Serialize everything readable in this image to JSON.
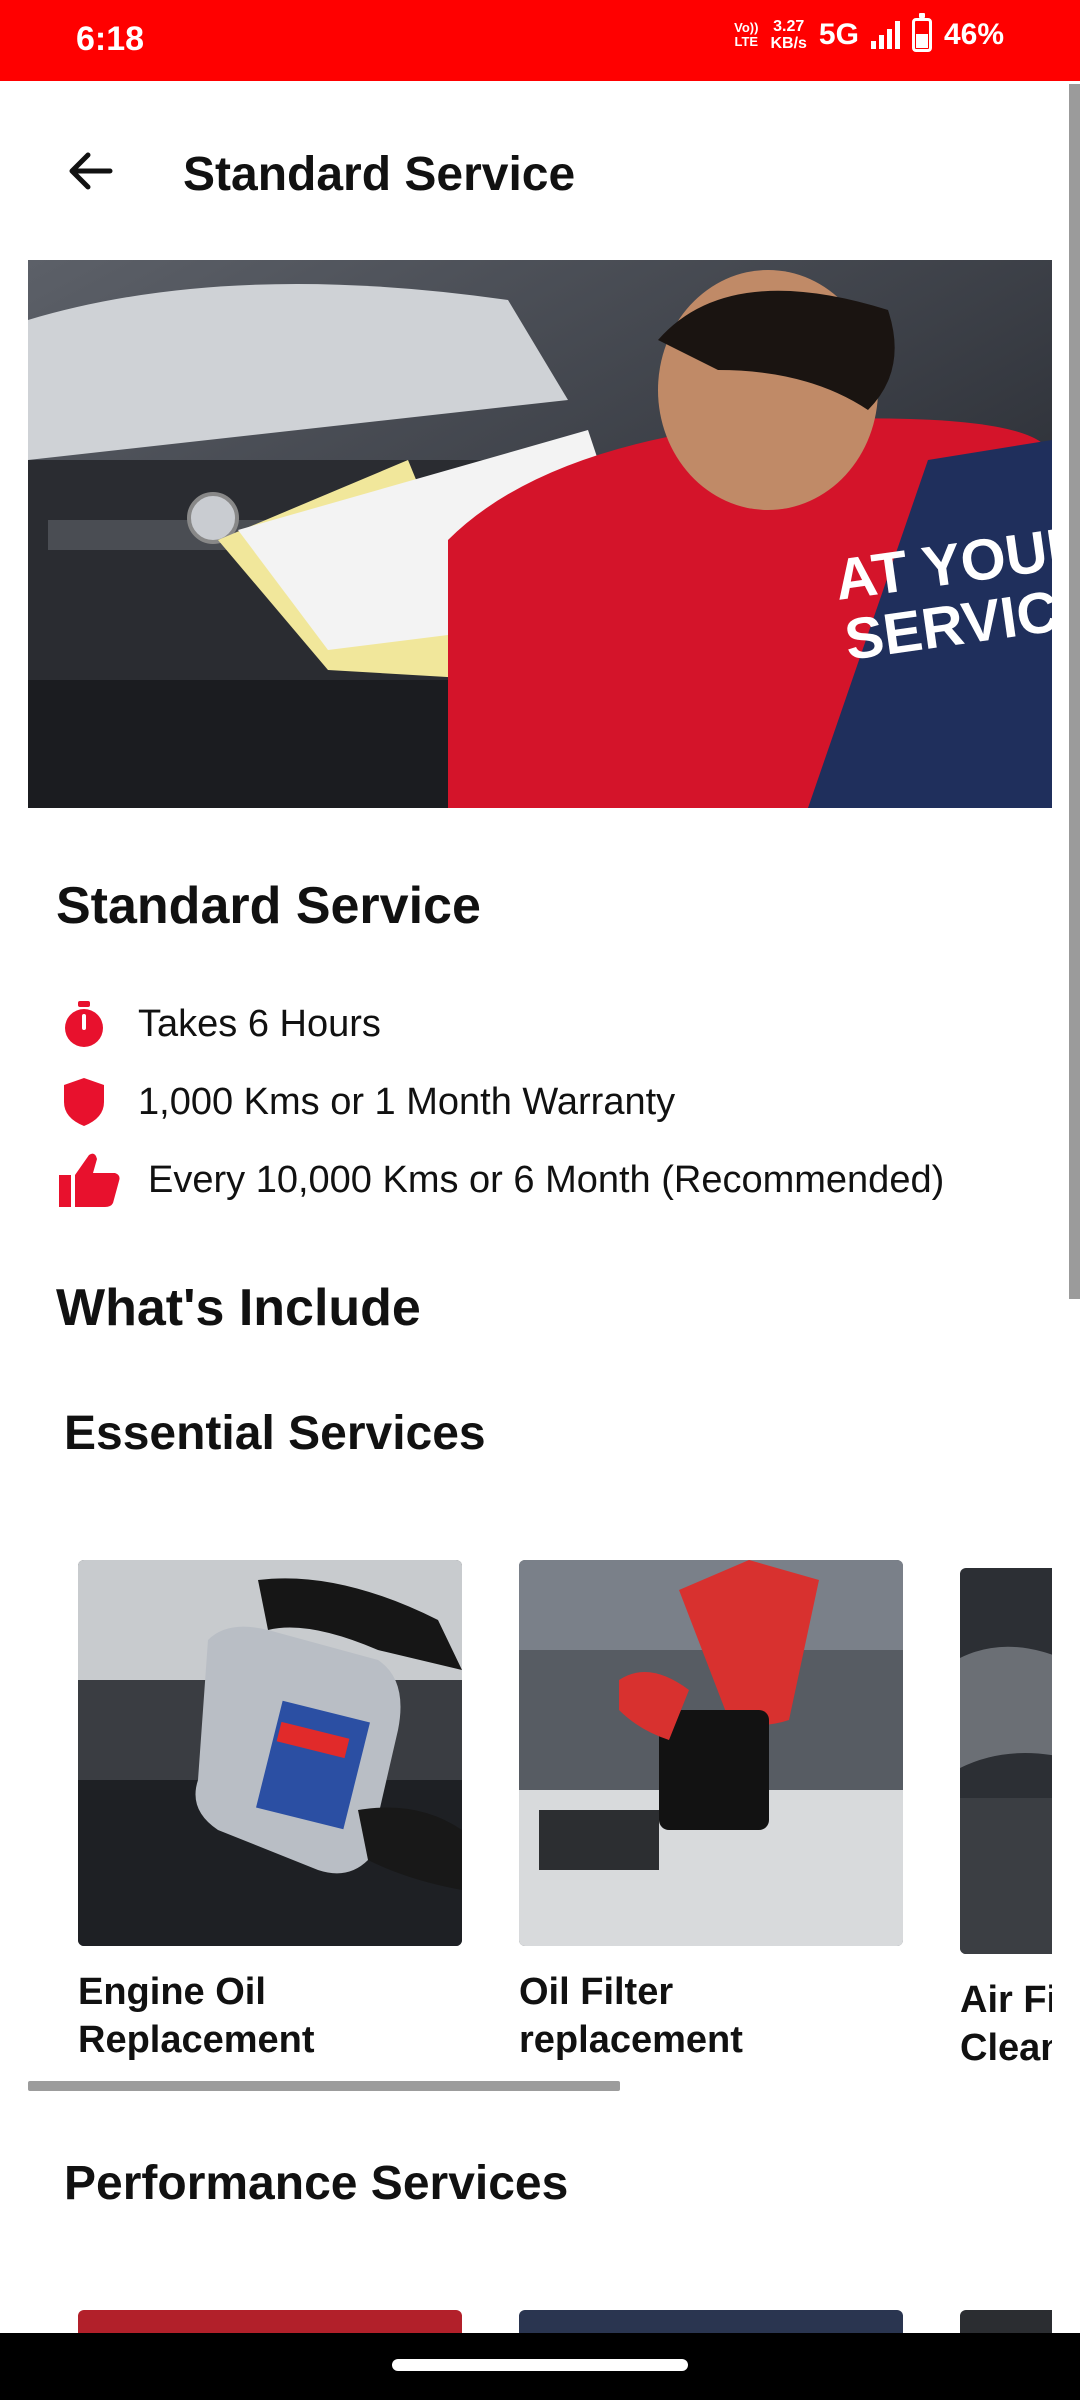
{
  "status_bar": {
    "time": "6:18",
    "volte_line1": "Vo))",
    "volte_line2": "LTE",
    "speed_line1": "3.27",
    "speed_line2": "KB/s",
    "network": "5G",
    "battery": "46%"
  },
  "app_bar": {
    "title": "Standard Service"
  },
  "service": {
    "title": "Standard Service",
    "features": [
      {
        "icon": "stopwatch-icon",
        "text": "Takes 6 Hours"
      },
      {
        "icon": "shield-icon",
        "text": "1,000 Kms or 1 Month Warranty"
      },
      {
        "icon": "thumbs-up-icon",
        "text": "Every 10,000 Kms or 6 Month (Recommended)"
      }
    ]
  },
  "includes": {
    "title": "What's Include",
    "essential": {
      "title": "Essential Services",
      "items": [
        {
          "line1": "Engine Oil",
          "line2": "Replacement"
        },
        {
          "line1": "Oil Filter",
          "line2": "replacement"
        },
        {
          "line1": "Air Fil",
          "line2": "Clean"
        }
      ]
    },
    "performance": {
      "title": "Performance Services"
    }
  },
  "colors": {
    "accent": "#ff0000",
    "icon_red": "#e8112d"
  }
}
